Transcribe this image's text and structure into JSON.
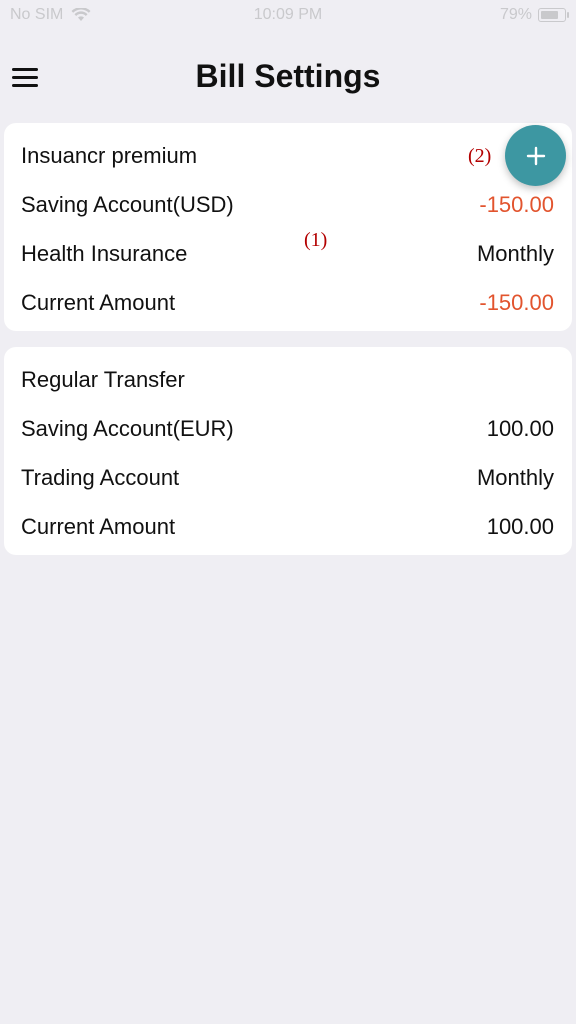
{
  "status_bar": {
    "carrier": "No SIM",
    "time": "10:09 PM",
    "battery": "79%"
  },
  "nav": {
    "title": "Bill Settings"
  },
  "cards": [
    {
      "rows": [
        {
          "left": "Insuancr premium",
          "right": ""
        },
        {
          "left": "Saving Account(USD)",
          "right": "-150.00"
        },
        {
          "left": "Health Insurance",
          "right": "Monthly"
        },
        {
          "left": "Current Amount",
          "right": "-150.00"
        }
      ]
    },
    {
      "rows": [
        {
          "left": "Regular Transfer",
          "right": ""
        },
        {
          "left": "Saving Account(EUR)",
          "right": "100.00"
        },
        {
          "left": "Trading Account",
          "right": "Monthly"
        },
        {
          "left": "Current Amount",
          "right": "100.00"
        }
      ]
    }
  ],
  "annotations": {
    "one": "(1)",
    "two": "(2)"
  },
  "colors": {
    "negative": "#e2542e",
    "fab": "#3d97a2",
    "annotation": "#b30000"
  },
  "icons": [
    "wifi-icon",
    "battery-icon",
    "menu-icon",
    "plus-icon"
  ]
}
